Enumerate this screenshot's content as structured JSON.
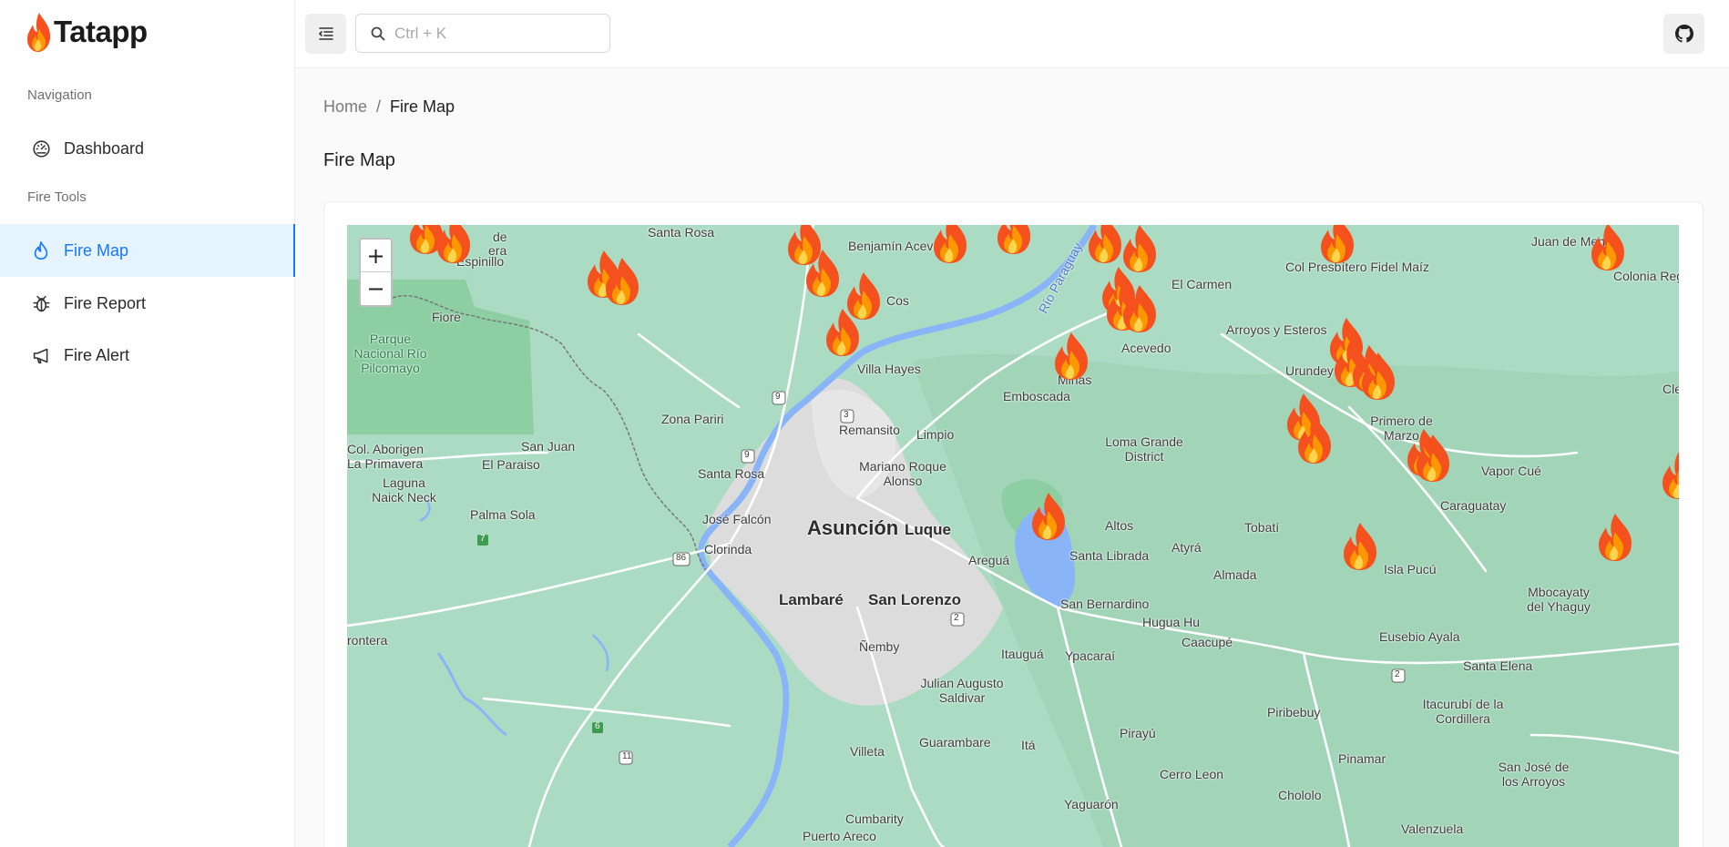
{
  "app": {
    "name": "Tatapp"
  },
  "sidebar": {
    "sections": [
      {
        "title": "Navigation"
      },
      {
        "title": "Fire Tools"
      }
    ],
    "items": [
      {
        "label": "Dashboard",
        "icon": "dashboard-icon"
      },
      {
        "label": "Fire Map",
        "icon": "fire-icon",
        "active": true
      },
      {
        "label": "Fire Report",
        "icon": "bug-icon"
      },
      {
        "label": "Fire Alert",
        "icon": "megaphone-icon"
      }
    ]
  },
  "header": {
    "search_placeholder": "Ctrl + K",
    "toggle_icon": "menu-fold-icon",
    "github_icon": "github-icon"
  },
  "breadcrumb": {
    "home": "Home",
    "separator": "/",
    "current": "Fire Map"
  },
  "page": {
    "title": "Fire Map"
  },
  "map": {
    "zoom_in": "+",
    "zoom_out": "−",
    "places": [
      "Santa Rosa",
      "Benjamín Aceval",
      "Juan de Mena",
      "Colonia Regina Mareco",
      "Espinillo",
      "Col Presbítero Fidel Maíz",
      "El Carmen",
      "Fiore",
      "Arroyos y Esteros",
      "Parque Nacional Río Pilcomayo",
      "Acevedo",
      "Urundey",
      "Villa Hayes",
      "Minas",
      "Emboscada",
      "Zona Pariri",
      "Primero de Marzo",
      "Remansito",
      "Limpio",
      "Col. Aborigen La Primavera",
      "San Juan",
      "Loma Grande District",
      "El Paraiso",
      "Mariano Roque Alonso",
      "Vapor Cué",
      "Laguna Naick Neck",
      "Santa Rosa",
      "Palma Sola",
      "José Falcón",
      "Caraguatay",
      "Asunción",
      "Luque",
      "Altos",
      "Tobatí",
      "Clorinda",
      "Atyrá",
      "Areguá",
      "Santa Librada",
      "Almada",
      "Isla Pucú",
      "Mbocayaty del Yhaguy",
      "Lambaré",
      "San Lorenzo",
      "San Bernardino",
      "Hugua Hu",
      "Caacupé",
      "Eusebio Ayala",
      "Ñemby",
      "Itauguá",
      "Ypacaraí",
      "Santa Elena",
      "Itacurubí de la Cordillera",
      "Julian Augusto Saldivar",
      "Piribebuy",
      "Guarambare",
      "Pirayú",
      "Itá",
      "Pinamar",
      "Villeta",
      "San José de los Arroyos",
      "Cerro Leon",
      "Chololo",
      "Yaguarón",
      "Cumbarity",
      "Valenzuela",
      "Puerto Areco",
      "Río Paraguay",
      "rontera",
      "Cos",
      "Cle",
      "de",
      "era"
    ],
    "route_shields": [
      "9",
      "3",
      "9",
      "86",
      "7",
      "2",
      "2",
      "6",
      "11"
    ],
    "fire_markers_count": 30,
    "marker_icon": "fire-marker-icon"
  }
}
